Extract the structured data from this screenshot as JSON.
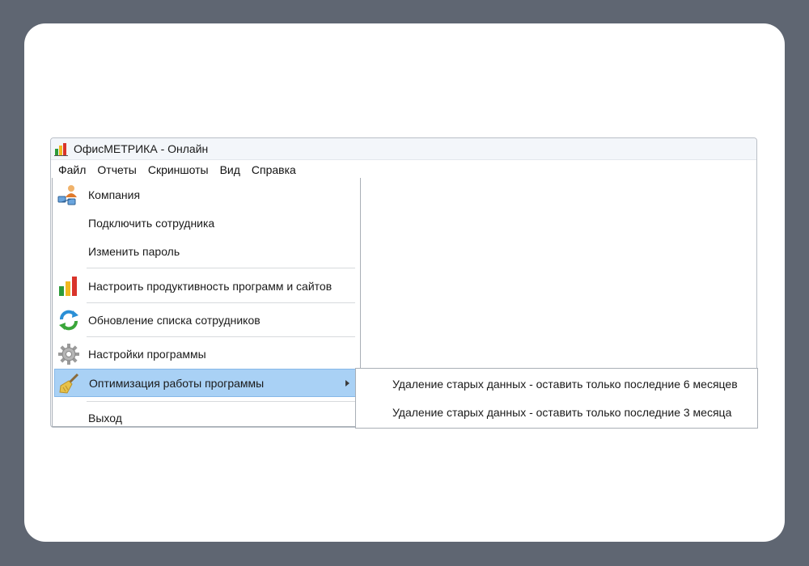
{
  "window": {
    "title": "ОфисМЕТРИКА - Онлайн",
    "icon": "bar-chart-icon"
  },
  "menubar": {
    "items": [
      "Файл",
      "Отчеты",
      "Скриншоты",
      "Вид",
      "Справка"
    ]
  },
  "file_menu": {
    "items": [
      {
        "label": "Компания",
        "icon": "company-users-icon"
      },
      {
        "label": "Подключить сотрудника",
        "icon": ""
      },
      {
        "label": "Изменить пароль",
        "icon": ""
      },
      {
        "label": "Настроить продуктивность программ и сайтов",
        "icon": "bar-chart-icon"
      },
      {
        "label": "Обновление списка сотрудников",
        "icon": "refresh-icon"
      },
      {
        "label": "Настройки программы",
        "icon": "gear-icon"
      },
      {
        "label": "Оптимизация работы программы",
        "icon": "broom-icon",
        "highlighted": true
      },
      {
        "label": "Выход",
        "icon": ""
      }
    ]
  },
  "submenu": {
    "items": [
      "Удаление старых данных - оставить только последние 6 месяцев",
      "Удаление старых данных - оставить только последние 3 месяца"
    ]
  },
  "colors": {
    "backdrop": "#5f6672",
    "highlight": "#a9d1f5",
    "highlight_border": "#86b8e8"
  }
}
